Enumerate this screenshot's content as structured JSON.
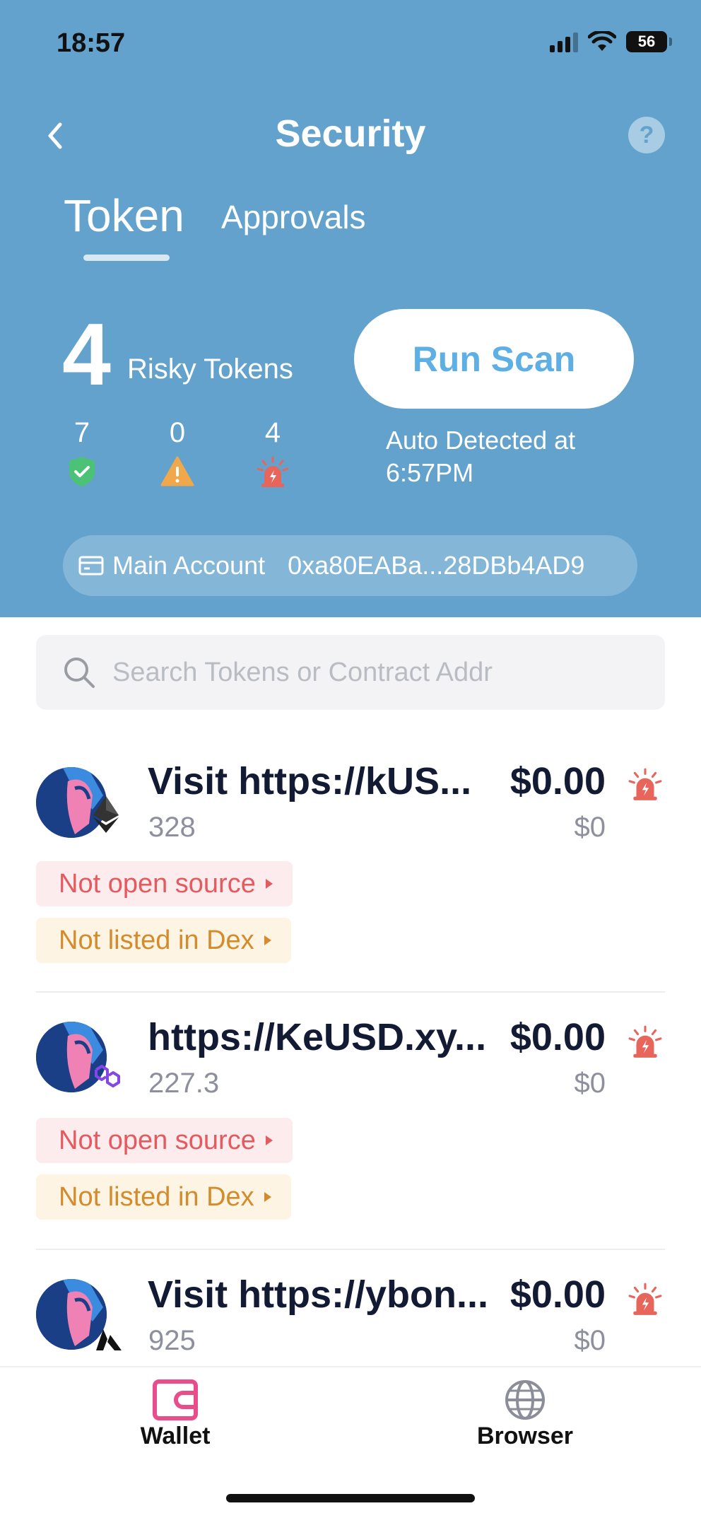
{
  "status_bar": {
    "time": "18:57",
    "battery": "56"
  },
  "header": {
    "title": "Security",
    "help_label": "?"
  },
  "tabs": [
    {
      "label": "Token",
      "active": true
    },
    {
      "label": "Approvals",
      "active": false
    }
  ],
  "summary": {
    "risky_count": "4",
    "risky_label": "Risky Tokens",
    "safe_count": "7",
    "warning_count": "0",
    "risk_count": "4",
    "run_scan_label": "Run Scan",
    "auto_detected": "Auto Detected at 6:57PM"
  },
  "account": {
    "name": "Main Account",
    "address": "0xa80EABa...28DBb4AD9"
  },
  "search": {
    "placeholder": "Search Tokens or Contract Addr"
  },
  "tokens": [
    {
      "name": "Visit https://kUS...",
      "amount": "328",
      "price": "$0.00",
      "value": "$0",
      "chain_icon": "ethereum-icon",
      "tags": [
        "Not open source",
        "Not listed in Dex"
      ]
    },
    {
      "name": "https://KeUSD.xy...",
      "amount": "227.3",
      "price": "$0.00",
      "value": "$0",
      "chain_icon": "polygon-icon",
      "tags": [
        "Not open source",
        "Not listed in Dex"
      ]
    },
    {
      "name": "Visit https://ybon...",
      "amount": "925",
      "price": "$0.00",
      "value": "$0",
      "chain_icon": "arbitrum-icon",
      "tags": []
    }
  ],
  "nav": {
    "wallet": "Wallet",
    "browser": "Browser"
  },
  "colors": {
    "header_bg": "#62a2cd",
    "accent": "#5eafe3",
    "risk_red": "#e8655c",
    "warn_orange": "#f0a84a",
    "safe_green": "#4cc277",
    "wallet_pink": "#e94d8b"
  }
}
